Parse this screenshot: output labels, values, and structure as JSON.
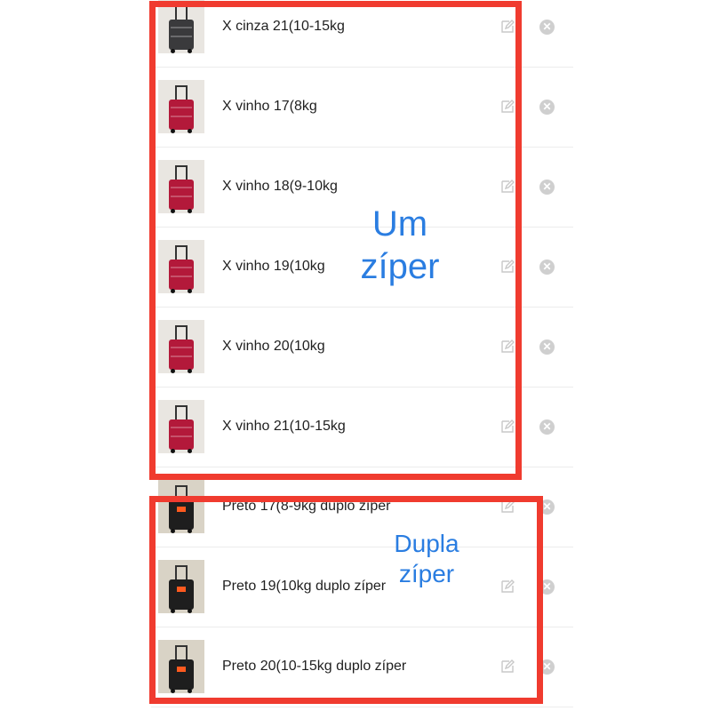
{
  "items": [
    {
      "label": "X cinza 21(10-15kg",
      "color": "#3a3a3c"
    },
    {
      "label": "X vinho 17(8kg",
      "color": "#b3193a"
    },
    {
      "label": "X vinho 18(9-10kg",
      "color": "#b3193a"
    },
    {
      "label": "X vinho 19(10kg",
      "color": "#b3193a"
    },
    {
      "label": "X vinho 20(10kg",
      "color": "#b3193a"
    },
    {
      "label": "X vinho 21(10-15kg",
      "color": "#b3193a"
    },
    {
      "label": "Preto 17(8-9kg duplo zíper",
      "color": "#1e1e1e"
    },
    {
      "label": "Preto 19(10kg duplo zíper",
      "color": "#1e1e1e"
    },
    {
      "label": "Preto 20(10-15kg duplo zíper",
      "color": "#1e1e1e"
    }
  ],
  "icons": {
    "edit": "edit-icon",
    "remove": "remove-icon"
  },
  "annotations": {
    "single_zipper_line1": "Um",
    "single_zipper_line2": "zíper",
    "double_zipper_line1": "Dupla",
    "double_zipper_line2": "zíper"
  },
  "colors": {
    "frame": "#f03b2f",
    "annotation_text": "#2a7de1"
  }
}
